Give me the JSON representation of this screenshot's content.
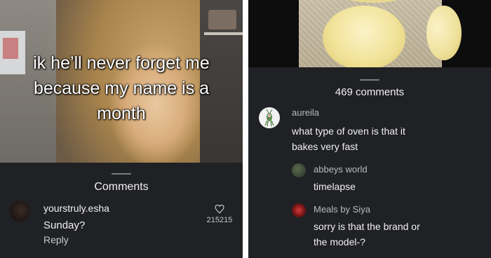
{
  "left": {
    "overlay_text": "ik he’ll never forget me\nbecause my name is a\nmonth",
    "sheet_title": "Comments",
    "comment": {
      "username": "yourstruly.esha",
      "text": "Sunday?",
      "reply_label": "Reply",
      "like_count": "215215",
      "like_icon": "heart-outline-icon"
    }
  },
  "right": {
    "sheet_title": "469 comments",
    "comments": [
      {
        "username": "aureila",
        "text": "what type of oven is that it\nbakes very fast",
        "avatar": "plankton-avatar"
      },
      {
        "username": "abbeys world",
        "text": "timelapse",
        "avatar": "plant-avatar"
      },
      {
        "username": "Meals by Siya",
        "text": "sorry is that the brand or\nthe model-?",
        "avatar": "red-logo-avatar"
      }
    ]
  }
}
